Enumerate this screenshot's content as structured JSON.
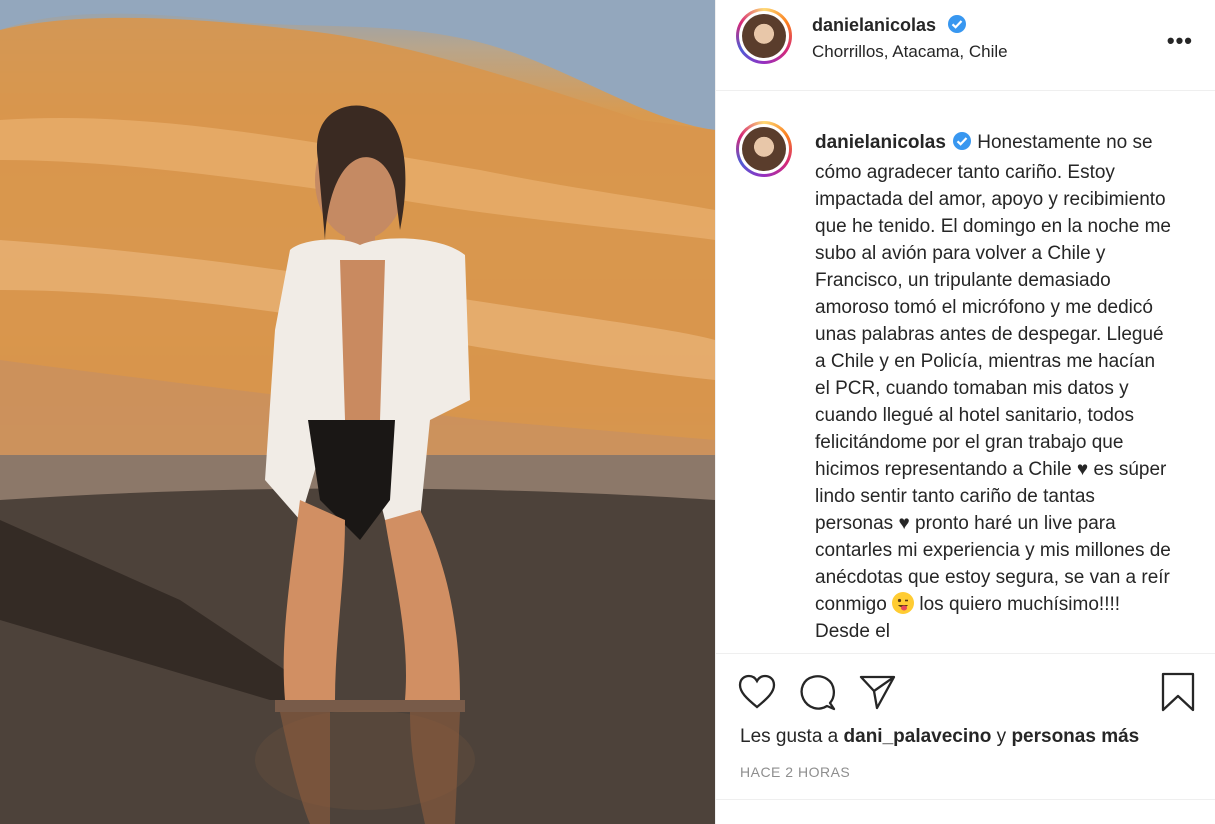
{
  "post": {
    "username": "danielanicolas",
    "location": "Chorrillos, Atacama, Chile",
    "caption_username": "danielanicolas",
    "caption_text": "Honestamente no se cómo agradecer tanto cariño. Estoy impactada del amor, apoyo y recibimiento que he tenido. El domingo en la noche me subo al avión para volver a Chile y Francisco, un tripulante demasiado amoroso tomó el micrófono y me dedicó unas palabras antes de despegar. Llegué a Chile y en Policía, mientras me hacían el PCR, cuando tomaban mis datos y cuando llegué al hotel sanitario, todos felicitándome por el gran trabajo que hicimos representando a Chile ♥ es súper lindo sentir tanto cariño de tantas personas ♥ pronto haré un live para contarles mi experiencia y mis millones de anécdotas que estoy segura, se van a reír conmigo",
    "caption_tail": " los",
    "caption_cut": "quiero muchísimo!!!! Desde el",
    "likes_prefix": "Les gusta a ",
    "likes_user": "dani_palavecino",
    "likes_mid": " y ",
    "likes_rest": "personas más",
    "time": "HACE 2 HORAS"
  },
  "icons": {
    "verified": "verified-badge-icon",
    "more": "more-options-icon",
    "like": "heart-icon",
    "comment": "comment-icon",
    "share": "share-paper-plane-icon",
    "save": "bookmark-icon",
    "emoji": "winking-tongue-emoji"
  },
  "colors": {
    "verified_blue": "#3897f0",
    "meta_grey": "#8e8e8e",
    "text": "#262626"
  },
  "more_glyph": "•••"
}
